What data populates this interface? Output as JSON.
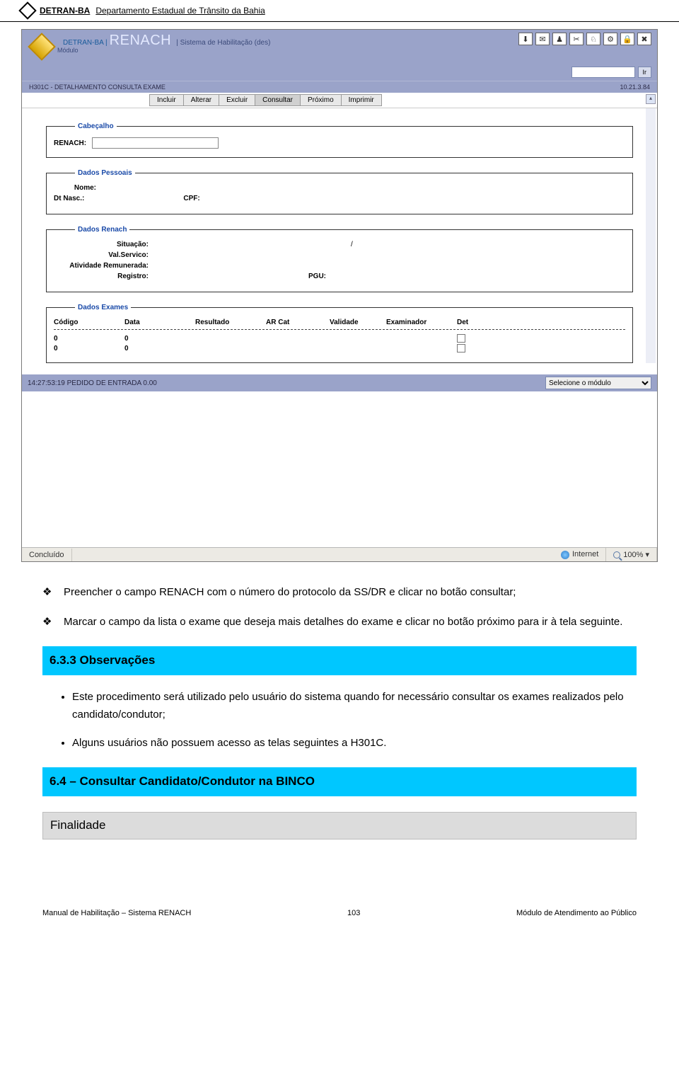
{
  "page_header": {
    "org_short": "DETRAN-BA",
    "org_long": "Departamento Estadual de Trânsito da Bahia"
  },
  "banner": {
    "prefix": "DETRAN-BA  |",
    "brand": "RENACH",
    "suffix": "|  Sistema de Habilitação (des)",
    "modulo": "Módulo"
  },
  "ir": {
    "btn": "Ir"
  },
  "subheader": {
    "left": "H301C - DETALHAMENTO CONSULTA EXAME",
    "right": "10.21.3.84"
  },
  "toolbar": {
    "incluir": "Incluir",
    "alterar": "Alterar",
    "excluir": "Excluir",
    "consultar": "Consultar",
    "proximo": "Próximo",
    "imprimir": "Imprimir"
  },
  "fs_cabecalho": {
    "legend": "Cabeçalho",
    "renach": "RENACH:"
  },
  "fs_pessoais": {
    "legend": "Dados Pessoais",
    "nome": "Nome:",
    "dtnasc": "Dt Nasc.:",
    "cpf": "CPF:"
  },
  "fs_renach": {
    "legend": "Dados Renach",
    "situacao": "Situação:",
    "slash": "/",
    "valserv": "Val.Servico:",
    "atrem": "Atividade Remunerada:",
    "registro": "Registro:",
    "pgu": "PGU:"
  },
  "fs_exames": {
    "legend": "Dados Exames",
    "cols": {
      "codigo": "Código",
      "data": "Data",
      "resultado": "Resultado",
      "arcat": "AR Cat",
      "validade": "Validade",
      "examinador": "Examinador",
      "det": "Det"
    },
    "rows": [
      {
        "codigo": "0",
        "data": "0"
      },
      {
        "codigo": "0",
        "data": "0"
      }
    ]
  },
  "status": {
    "left": "14:27:53:19 PEDIDO DE ENTRADA 0.00",
    "select": "Selecione o módulo"
  },
  "iebar": {
    "concluido": "Concluído",
    "internet": "Internet",
    "zoom": "100%"
  },
  "body": {
    "p1": "Preencher o campo RENACH com o número do protocolo da SS/DR e clicar no botão consultar;",
    "p2": "Marcar o campo da lista o exame que deseja mais detalhes do exame e clicar no botão próximo para ir à tela seguinte.",
    "h633": "6.3.3 Observações",
    "li1": "Este procedimento será utilizado pelo usuário do sistema quando for necessário consultar os exames realizados pelo candidato/condutor;",
    "li2": "Alguns usuários não possuem acesso as telas seguintes a H301C.",
    "h64": "6.4 – Consultar Candidato/Condutor na BINCO",
    "fin": "Finalidade"
  },
  "footer": {
    "left": "Manual de Habilitação – Sistema RENACH",
    "center": "103",
    "right": "Módulo de Atendimento ao Público"
  }
}
